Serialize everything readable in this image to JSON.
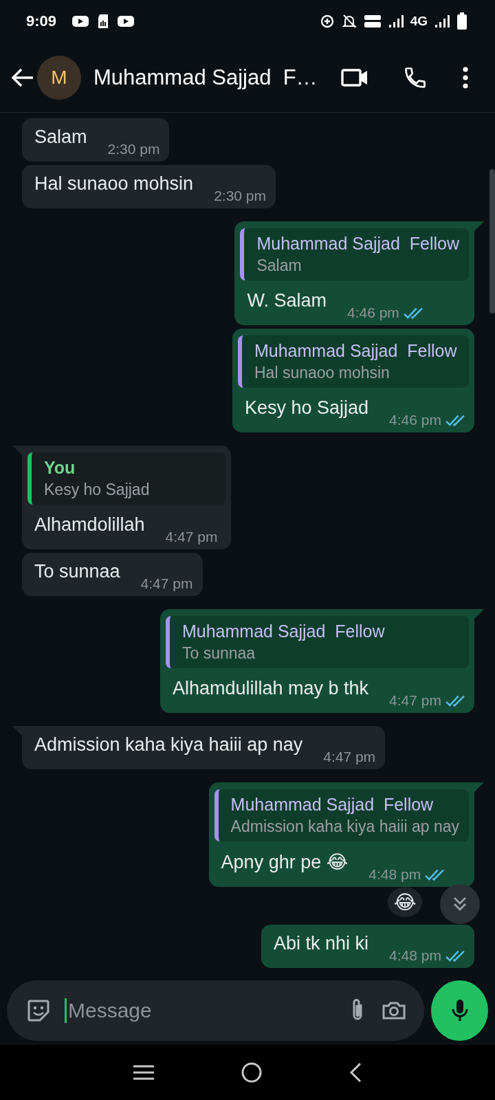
{
  "status_bar": {
    "time": "9:09",
    "network": "4G"
  },
  "header": {
    "avatar_letter": "M",
    "title": "Muhammad Sajjad  F…"
  },
  "messages": [
    {
      "kind": "incoming",
      "text": "Salam",
      "time": "2:30 pm"
    },
    {
      "kind": "incoming",
      "text": "Hal sunaoo mohsin",
      "time": "2:30 pm"
    },
    {
      "kind": "outgoing",
      "quote": {
        "kind": "contact",
        "author": "Muhammad Sajjad  Fellow",
        "text": "Salam"
      },
      "text": "W. Salam",
      "time": "4:46 pm",
      "read": true
    },
    {
      "kind": "outgoing",
      "quote": {
        "kind": "contact",
        "author": "Muhammad Sajjad  Fellow",
        "text": "Hal sunaoo mohsin"
      },
      "text": "Kesy ho Sajjad",
      "time": "4:46 pm",
      "read": true
    },
    {
      "kind": "incoming",
      "quote": {
        "kind": "self",
        "author": "You",
        "text": "Kesy ho Sajjad"
      },
      "text": "Alhamdolillah",
      "time": "4:47 pm"
    },
    {
      "kind": "incoming",
      "text": "To sunnaa",
      "time": "4:47 pm"
    },
    {
      "kind": "outgoing",
      "quote": {
        "kind": "contact",
        "author": "Muhammad Sajjad  Fellow",
        "text": "To sunnaa"
      },
      "text": "Alhamdulillah may b thk",
      "time": "4:47 pm",
      "read": true
    },
    {
      "kind": "incoming",
      "text": "Admission kaha kiya haiii ap nay",
      "time": "4:47 pm"
    },
    {
      "kind": "outgoing",
      "quote": {
        "kind": "contact",
        "author": "Muhammad Sajjad  Fellow",
        "text": "Admission kaha kiya haiii ap nay"
      },
      "text": "Apny ghr pe 😂",
      "time": "4:48 pm",
      "read": true,
      "reaction": "😂"
    },
    {
      "kind": "outgoing",
      "text": "Abi tk nhi ki",
      "time": "4:48 pm",
      "read": true
    }
  ],
  "composer": {
    "placeholder": "Message"
  }
}
